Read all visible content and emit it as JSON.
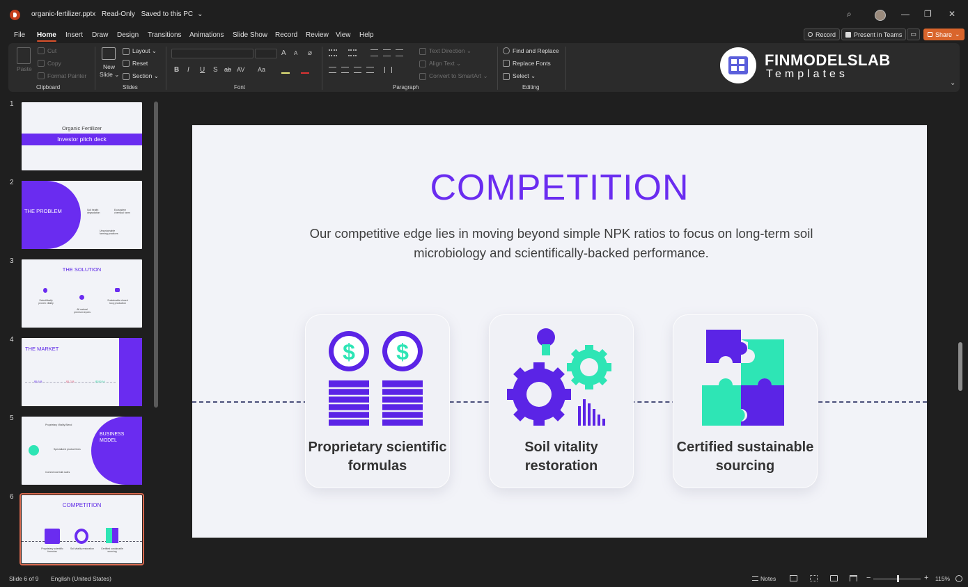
{
  "titlebar": {
    "filename": "organic-fertilizer.pptx",
    "mode": "Read-Only",
    "save_status": "Saved to this PC",
    "save_chevron": "⌄",
    "search_glyph": "⌕",
    "min_glyph": "—",
    "max_glyph": "❐",
    "close_glyph": "✕"
  },
  "menu": {
    "tabs": [
      "File",
      "Home",
      "Insert",
      "Draw",
      "Design",
      "Transitions",
      "Animations",
      "Slide Show",
      "Record",
      "Review",
      "View",
      "Help"
    ],
    "active": "Home",
    "record_label": "Record",
    "present_label": "Present in Teams",
    "share_label": "Share",
    "share_chevron": "⌄",
    "comment_glyph": "▭"
  },
  "ribbon": {
    "clipboard": {
      "paste": "Paste",
      "cut": "Cut",
      "copy": "Copy",
      "format_painter": "Format Painter",
      "label": "Clipboard"
    },
    "slides": {
      "new_slide": "New",
      "new_slide_2": "Slide ⌄",
      "layout": "Layout ⌄",
      "reset": "Reset",
      "section": "Section ⌄",
      "label": "Slides"
    },
    "font": {
      "label": "Font",
      "bold": "B",
      "italic": "I",
      "underline": "U",
      "strike": "S",
      "shadow": "ab",
      "spacing": "AV",
      "case": "Aa",
      "grow": "A",
      "shrink": "A"
    },
    "paragraph": {
      "label": "Paragraph",
      "text_direction": "Text Direction ⌄",
      "align_text": "Align Text ⌄",
      "smartart": "Convert to SmartArt ⌄"
    },
    "editing": {
      "label": "Editing",
      "find_replace": "Find and Replace",
      "replace_fonts": "Replace Fonts",
      "select": "Select ⌄"
    },
    "collapse_glyph": "⌄"
  },
  "brand": {
    "name": "FINMODELSLAB",
    "sub": "Templates"
  },
  "thumbnails": {
    "nums": [
      "1",
      "2",
      "3",
      "4",
      "5",
      "6"
    ],
    "s1": {
      "title": "Organic Fertilizer",
      "band": "Investor pitch deck"
    },
    "s2": {
      "title": "THE PROBLEM",
      "i1": "Soil health degradation",
      "i2": "Ecosystem chemical harm",
      "i3": "Unsustainable farming practices"
    },
    "s3": {
      "title": "THE SOLUTION",
      "i1": "Scientifically proven vitality",
      "i2": "All natural premium inputs",
      "i3": "Sustainable closed loop production"
    },
    "s4": {
      "title": "THE MARKET",
      "v1": "$5.5 B",
      "v2": "$1.2 B",
      "v3": "$350 M"
    },
    "s5": {
      "title": "BUSINESS",
      "title2": "MODEL",
      "i1": "Proprietary Vitality Blend",
      "i2": "Specialized product lines",
      "i3": "Commercial bulk sales"
    },
    "s6": {
      "title": "COMPETITION",
      "c1": "Proprietary scientific formulas",
      "c2": "Soil vitality restoration",
      "c3": "Certified sustainable sourcing"
    }
  },
  "slide": {
    "title": "COMPETITION",
    "subtitle": "Our competitive edge lies in moving beyond simple NPK ratios to focus on long-term soil microbiology and scientifically-backed performance.",
    "cards": [
      {
        "label": "Proprietary scientific formulas",
        "icon": "coin-stacks-icon"
      },
      {
        "label": "Soil vitality restoration",
        "icon": "gears-bulb-icon"
      },
      {
        "label": "Certified sustainable sourcing",
        "icon": "puzzle-icon"
      }
    ],
    "dollar": "$",
    "colors": {
      "purple": "#5b24e6",
      "teal": "#2ee5b5",
      "title": "#6a2cf0"
    }
  },
  "status": {
    "slide_count": "Slide 6 of 9",
    "language": "English (United States)",
    "notes": "Notes",
    "zoom": "115%",
    "minus": "−",
    "plus": "+"
  }
}
